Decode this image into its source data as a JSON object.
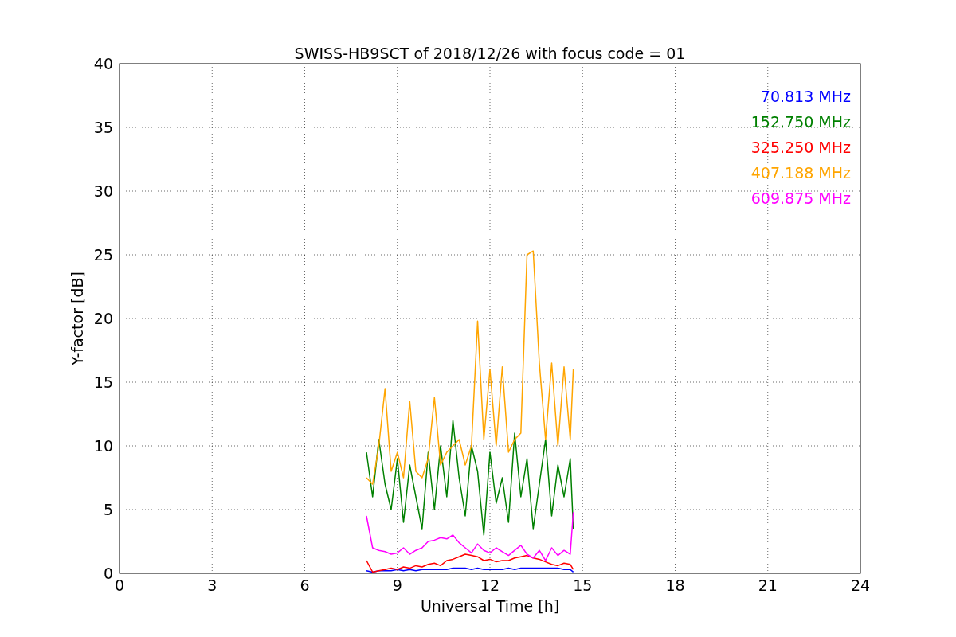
{
  "chart_data": {
    "type": "line",
    "title": "SWISS-HB9SCT of 2018/12/26 with focus code = 01",
    "xlabel": "Universal Time [h]",
    "ylabel": "Y-factor [dB]",
    "x": [
      8.0,
      8.2,
      8.4,
      8.6,
      8.8,
      9.0,
      9.2,
      9.4,
      9.6,
      9.8,
      10.0,
      10.2,
      10.4,
      10.6,
      10.8,
      11.0,
      11.2,
      11.4,
      11.6,
      11.8,
      12.0,
      12.2,
      12.4,
      12.6,
      12.8,
      13.0,
      13.2,
      13.4,
      13.6,
      13.8,
      14.0,
      14.2,
      14.4,
      14.6,
      14.7
    ],
    "series": [
      {
        "name": "70.813 MHz",
        "color": "#0000ff",
        "values": [
          0.2,
          0.1,
          0.2,
          0.2,
          0.2,
          0.3,
          0.2,
          0.3,
          0.2,
          0.3,
          0.3,
          0.3,
          0.3,
          0.3,
          0.4,
          0.4,
          0.4,
          0.3,
          0.4,
          0.3,
          0.3,
          0.3,
          0.3,
          0.4,
          0.3,
          0.4,
          0.4,
          0.4,
          0.4,
          0.4,
          0.4,
          0.4,
          0.3,
          0.3,
          0.1
        ]
      },
      {
        "name": "152.750 MHz",
        "color": "#008000",
        "values": [
          9.5,
          6.0,
          10.5,
          7.0,
          5.0,
          9.0,
          4.0,
          8.5,
          6.0,
          3.5,
          9.5,
          5.0,
          10.0,
          6.0,
          12.0,
          7.5,
          4.5,
          10.0,
          8.0,
          3.0,
          9.5,
          5.5,
          7.5,
          4.0,
          11.0,
          6.0,
          9.0,
          3.5,
          7.0,
          10.5,
          4.5,
          8.5,
          6.0,
          9.0,
          3.5
        ]
      },
      {
        "name": "325.250 MHz",
        "color": "#ff0000",
        "values": [
          1.0,
          0.1,
          0.2,
          0.3,
          0.4,
          0.3,
          0.5,
          0.4,
          0.6,
          0.5,
          0.7,
          0.8,
          0.6,
          1.0,
          1.1,
          1.3,
          1.5,
          1.4,
          1.3,
          1.0,
          1.1,
          0.9,
          1.0,
          1.0,
          1.2,
          1.3,
          1.4,
          1.2,
          1.1,
          0.9,
          0.7,
          0.6,
          0.8,
          0.7,
          0.3
        ]
      },
      {
        "name": "407.188 MHz",
        "color": "#ffa500",
        "values": [
          7.5,
          7.0,
          10.0,
          14.5,
          8.0,
          9.5,
          7.5,
          13.5,
          8.0,
          7.5,
          9.0,
          13.8,
          8.5,
          9.5,
          10.0,
          10.5,
          8.5,
          10.0,
          19.8,
          10.5,
          16.0,
          10.0,
          16.2,
          9.5,
          10.5,
          11.0,
          25.0,
          25.3,
          16.5,
          10.5,
          16.5,
          10.0,
          16.2,
          10.5,
          16.0
        ]
      },
      {
        "name": "609.875 MHz",
        "color": "#ff00ff",
        "values": [
          4.5,
          2.0,
          1.8,
          1.7,
          1.5,
          1.6,
          2.0,
          1.5,
          1.8,
          2.0,
          2.5,
          2.6,
          2.8,
          2.7,
          3.0,
          2.4,
          2.0,
          1.6,
          2.3,
          1.8,
          1.6,
          2.0,
          1.7,
          1.4,
          1.8,
          2.2,
          1.5,
          1.2,
          1.8,
          1.0,
          2.0,
          1.4,
          1.8,
          1.5,
          4.8
        ]
      }
    ],
    "grid": true,
    "xlim": [
      0,
      24
    ],
    "ylim": [
      0,
      40
    ],
    "xticks": [
      0,
      3,
      6,
      9,
      12,
      15,
      18,
      21,
      24
    ],
    "yticks": [
      0,
      5,
      10,
      15,
      20,
      25,
      30,
      35,
      40
    ]
  }
}
